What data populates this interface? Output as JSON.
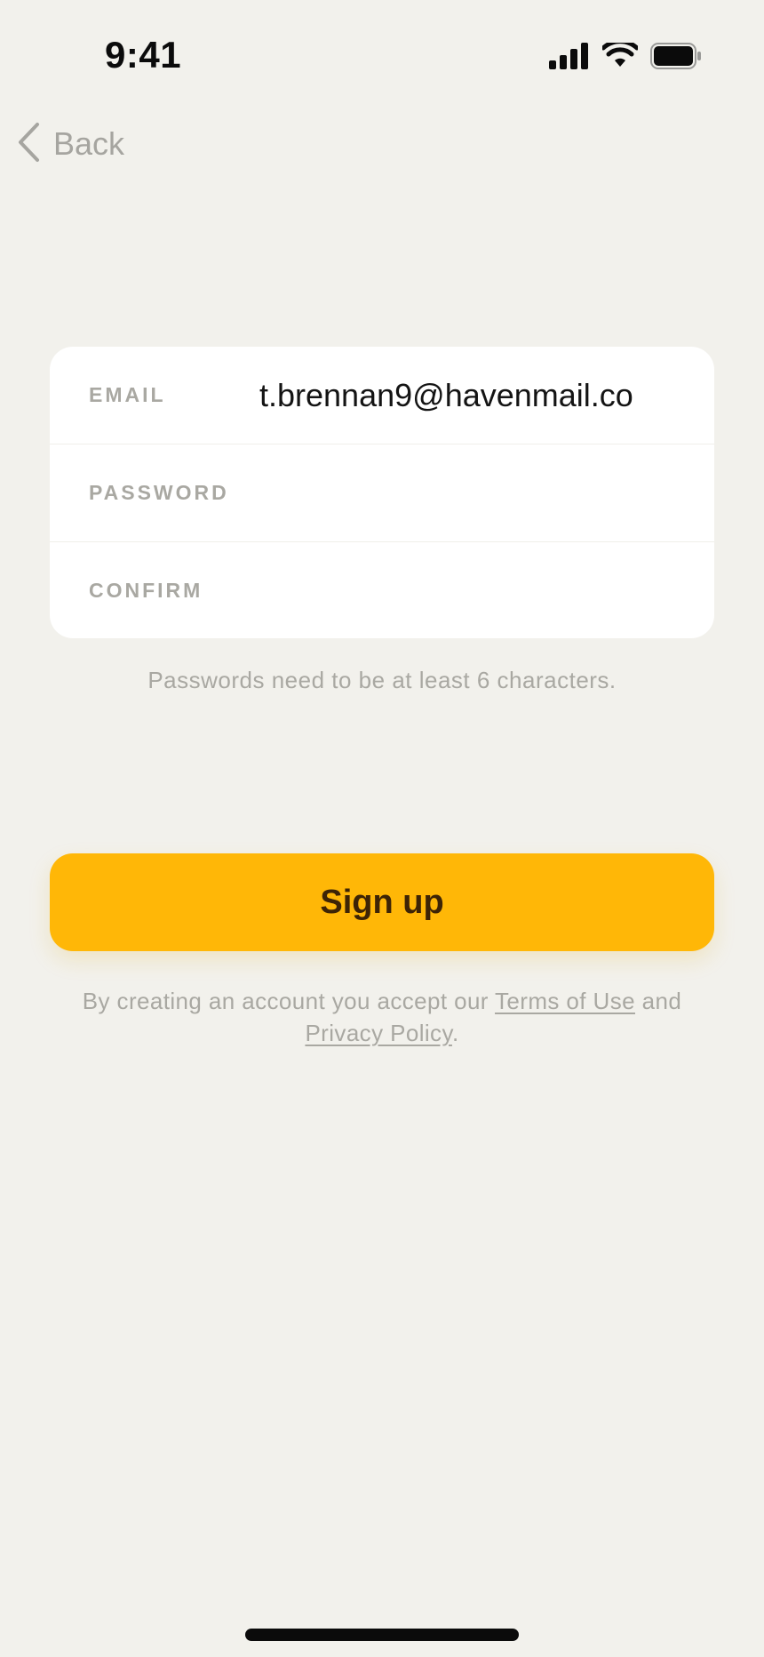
{
  "status_bar": {
    "time": "9:41",
    "icons": [
      "cellular-signal-icon",
      "wifi-icon",
      "battery-icon"
    ]
  },
  "nav": {
    "back_label": "Back",
    "back_icon": "chevron-left-icon"
  },
  "form": {
    "email_label": "EMAIL",
    "email_value": "t.brennan9@havenmail.co",
    "password_label": "PASSWORD",
    "password_value": "",
    "confirm_label": "CONFIRM",
    "confirm_value": ""
  },
  "hint": "Passwords need to be at least 6 characters.",
  "signup_button": "Sign up",
  "legal": {
    "prefix": "By creating an account you accept our ",
    "terms_link": "Terms of Use",
    "middle": " and ",
    "privacy_link": "Privacy Policy",
    "suffix": "."
  },
  "colors": {
    "background": "#f2f1ec",
    "accent": "#ffb707",
    "button_text": "#3d2406",
    "muted_text": "#a9a8a2"
  }
}
